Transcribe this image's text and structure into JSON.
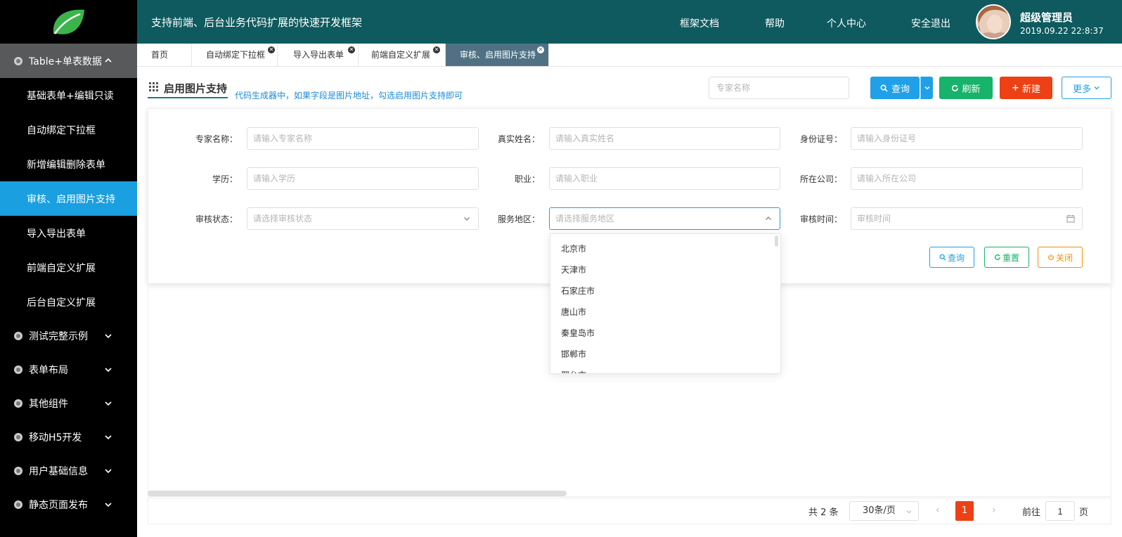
{
  "header": {
    "slogan": "支持前端、后台业务代码扩展的快速开发框架",
    "nav": [
      "框架文档",
      "帮助",
      "个人中心",
      "安全退出"
    ],
    "user_name": "超级管理员",
    "datetime": "2019.09.22 22:8:37"
  },
  "sidebar": {
    "groups": [
      {
        "label": "Table+单表数据",
        "open": true,
        "items": [
          "基础表单+编辑只读",
          "自动绑定下拉框",
          "新增编辑删除表单",
          "审核、启用图片支持",
          "导入导出表单",
          "前端自定义扩展",
          "后台自定义扩展"
        ],
        "active_index": 3
      },
      {
        "label": "测试完整示例"
      },
      {
        "label": "表单布局"
      },
      {
        "label": "其他组件"
      },
      {
        "label": "移动H5开发"
      },
      {
        "label": "用户基础信息"
      },
      {
        "label": "静态页面发布"
      }
    ]
  },
  "tabs": [
    {
      "label": "首页",
      "closable": false
    },
    {
      "label": "自动绑定下拉框",
      "closable": true
    },
    {
      "label": "导入导出表单",
      "closable": true
    },
    {
      "label": "前端自定义扩展",
      "closable": true
    },
    {
      "label": "审核、启用图片支持",
      "closable": true,
      "active": true
    }
  ],
  "page": {
    "title": "启用图片支持",
    "hint": "代码生成器中，如果字段是图片地址，勾选启用图片支持即可",
    "search_placeholder": "专家名称",
    "buttons": {
      "query": "查询",
      "refresh": "刷新",
      "new": "新建",
      "more": "更多"
    }
  },
  "filters": {
    "fields": [
      {
        "label": "专家名称：",
        "placeholder": "请输入专家名称"
      },
      {
        "label": "真实姓名：",
        "placeholder": "请输入真实姓名"
      },
      {
        "label": "身份证号：",
        "placeholder": "请输入身份证号"
      },
      {
        "label": "学历：",
        "placeholder": "请输入学历"
      },
      {
        "label": "职业：",
        "placeholder": "请输入职业"
      },
      {
        "label": "所在公司：",
        "placeholder": "请输入所在公司"
      },
      {
        "label": "审核状态：",
        "placeholder": "请选择审核状态"
      },
      {
        "label": "服务地区：",
        "placeholder": "请选择服务地区"
      },
      {
        "label": "审核时间：",
        "placeholder": "审核时间"
      }
    ],
    "buttons": {
      "query": "查询",
      "reset": "重置",
      "close": "关闭"
    }
  },
  "dropdown": {
    "options": [
      "北京市",
      "天津市",
      "石家庄市",
      "唐山市",
      "秦皇岛市",
      "邯郸市",
      "邢台市"
    ]
  },
  "pager": {
    "total": "共 2 条",
    "page_size": "30条/页",
    "current": "1",
    "goto_label": "前往",
    "goto_value": "1",
    "page_unit": "页"
  },
  "colors": {
    "topbar": "#0e5a5e",
    "active_menu": "#1a9fe0",
    "query": "#20a0e8",
    "refresh": "#17b36a",
    "new": "#ed4014",
    "close_btn": "#f29100"
  }
}
